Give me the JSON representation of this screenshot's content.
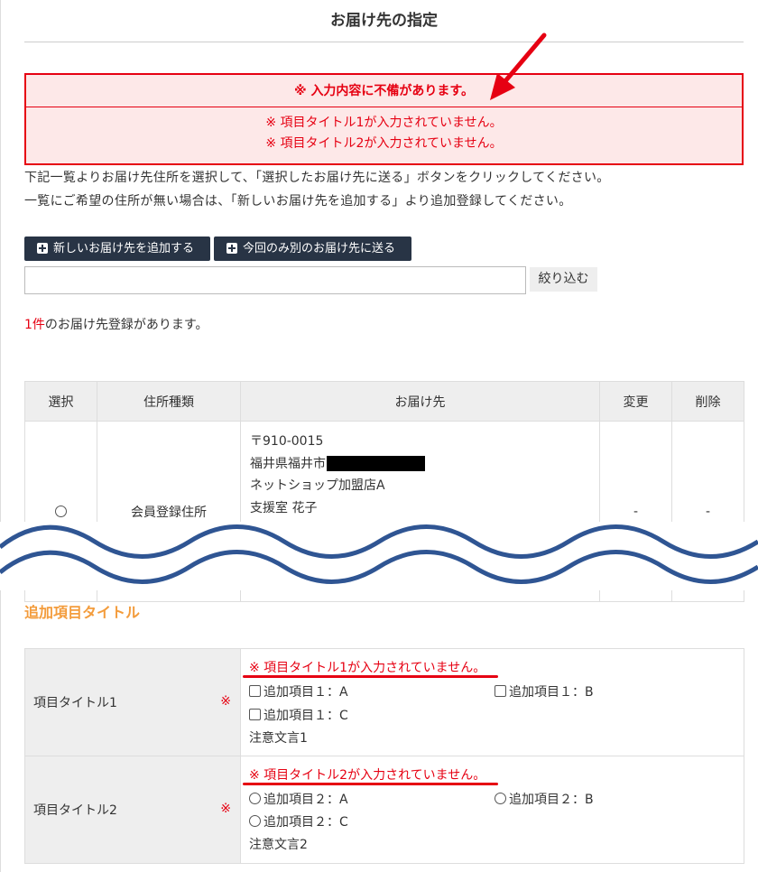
{
  "page": {
    "title": "お届け先の指定"
  },
  "error_box": {
    "heading": "※ 入力内容に不備があります。",
    "items": [
      "※ 項目タイトル1が入力されていません。",
      "※ 項目タイトル2が入力されていません。"
    ]
  },
  "description": [
    "下記一覧よりお届け先住所を選択して、「選択したお届け先に送る」ボタンをクリックしてください。",
    "一覧にご希望の住所が無い場合は、「新しいお届け先を追加する」より追加登録してください。"
  ],
  "buttons": {
    "add_new": "新しいお届け先を追加する",
    "send_other": "今回のみ別のお届け先に送る",
    "filter": "絞り込む"
  },
  "filter": {
    "value": "",
    "placeholder": ""
  },
  "count": {
    "number": "1件",
    "suffix": "のお届け先登録があります。"
  },
  "table": {
    "headers": [
      "選択",
      "住所種類",
      "お届け先",
      "変更",
      "削除"
    ],
    "rows": [
      {
        "type": "会員登録住所",
        "postal": "〒910-0015",
        "city": "福井県福井市",
        "shop": "ネットショップ加盟店A",
        "name": "支援室 花子",
        "edit": "-",
        "delete": "-"
      }
    ]
  },
  "section": {
    "title": "追加項目タイトル"
  },
  "items": [
    {
      "label": "項目タイトル1",
      "required_mark": "※",
      "error": "※ 項目タイトル1が入力されていません。",
      "options": [
        "追加項目１：A",
        "追加項目１：B",
        "追加項目１：C"
      ],
      "note": "注意文言1"
    },
    {
      "label": "項目タイトル2",
      "required_mark": "※",
      "error": "※ 項目タイトル2が入力されていません。",
      "options": [
        "追加項目２：A",
        "追加項目２：B",
        "追加項目２：C"
      ],
      "note": "注意文言2"
    }
  ],
  "colors": {
    "error_red": "#e60012",
    "dark_button": "#283445",
    "section_orange": "#f39c3c",
    "wave_blue": "#2f5593"
  }
}
